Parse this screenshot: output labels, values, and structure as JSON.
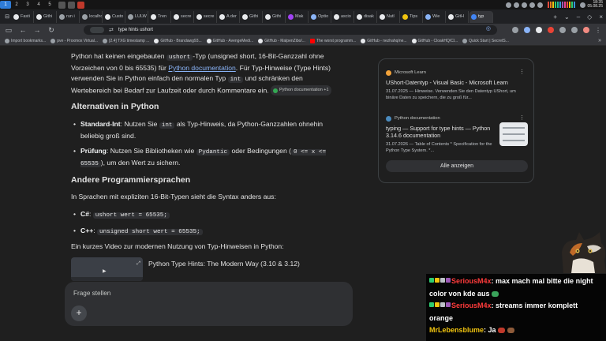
{
  "os": {
    "workspaces": [
      "1",
      "2",
      "3",
      "4",
      "5"
    ],
    "active_workspace": "1",
    "clock_time": "18:35",
    "clock_date": "05.08.25"
  },
  "tabs": [
    {
      "label": "Fasti"
    },
    {
      "label": "Githi"
    },
    {
      "label": "run i"
    },
    {
      "label": "localhos"
    },
    {
      "label": "Custo"
    },
    {
      "label": "LULW"
    },
    {
      "label": "Tren"
    },
    {
      "label": "secre"
    },
    {
      "label": "secre"
    },
    {
      "label": "A der"
    },
    {
      "label": "Githi"
    },
    {
      "label": "Githi"
    },
    {
      "label": "Mak"
    },
    {
      "label": "Optio"
    },
    {
      "label": "ascio"
    },
    {
      "label": "disak"
    },
    {
      "label": "Nutl"
    },
    {
      "label": "Tips"
    },
    {
      "label": "Wie"
    },
    {
      "label": "GitH"
    },
    {
      "label": "typ"
    }
  ],
  "omnibox": {
    "value": "type hints ushort"
  },
  "bookmarks": [
    {
      "label": "Import bookmarks...",
      "type": "plain"
    },
    {
      "label": "pve - Proxmox Virtual...",
      "type": "plain"
    },
    {
      "label": "[2.4] TXG timestamp ...",
      "type": "plain"
    },
    {
      "label": "GitHub - Brandawg93...",
      "type": "github"
    },
    {
      "label": "GitHub - AvengeMedi...",
      "type": "github"
    },
    {
      "label": "GitHub - MalpenZibo/...",
      "type": "github"
    },
    {
      "label": "The worst programm...",
      "type": "yt"
    },
    {
      "label": "GitHub - nezhahq/ne...",
      "type": "github"
    },
    {
      "label": "GitHub - CloakHQ/Cl...",
      "type": "github"
    },
    {
      "label": "Quick Start | SecretS...",
      "type": "plain"
    }
  ],
  "answer": {
    "p1_a": "Python hat keinen eingebauten ",
    "p1_code": "ushort",
    "p1_b": "-Typ (unsigned short, 16-Bit-Ganzzahl ohne Vorzeichen von 0 bis 65535) für ",
    "p1_link": "Python documentation",
    "p1_c": ". Für Typ-Hinweise (Type Hints) verwenden Sie in Python einfach den normalen Typ ",
    "p1_code2": "int",
    "p1_d": " und schränken den Wertebereich bei Bedarf zur Laufzeit oder durch Kommentare ein.",
    "p1_chip": "Python documentation +1",
    "h_alternatives": "Alternativen in Python",
    "alt1_term": "Standard-Int",
    "alt1_a": ": Nutzen Sie ",
    "alt1_code": "int",
    "alt1_b": " als Typ-Hinweis, da Python-Ganzzahlen ohnehin beliebig groß sind.",
    "alt2_term": "Prüfung",
    "alt2_a": ": Nutzen Sie Bibliotheken wie ",
    "alt2_code": "Pydantic",
    "alt2_b": " oder Bedingungen (",
    "alt2_code2": "0 <= x <= 65535",
    "alt2_c": "), um den Wert zu sichern.",
    "h_other": "Andere Programmiersprachen",
    "p_inlang": "In Sprachen mit expliziten 16-Bit-Typen sieht die Syntax anders aus:",
    "lang1_term": "C#",
    "lang1_code": "ushort wert = 65535;",
    "lang2_term": "C++",
    "lang2_code": "unsigned short wert = 65535;",
    "p_video": "Ein kurzes Video zur modernen Nutzung von Typ-Hinweisen in Python:",
    "video_title": "Python Type Hints: The Modern Way (3.10 & 3.12)"
  },
  "sources": {
    "items": [
      {
        "site": "Microsoft Learn",
        "title": "UShort-Datentyp - Visual Basic - Microsoft Learn",
        "snippet": "31.07.2025 — Hinweise. Verwenden Sie den Datentyp UShort, um binäre Daten zu speichern, die zu groß für...",
        "logo_color": "#f3a33a"
      },
      {
        "site": "Python documentation",
        "title": "typing — Support for type hints — Python 3.14.6 documentation",
        "snippet": "31.07.2026 — Table of Contents * Specification for the Python Type System. *...",
        "logo_color": "#4b8bbe"
      }
    ],
    "show_all": "Alle anzeigen"
  },
  "ask": {
    "placeholder": "Frage stellen",
    "plus": "+"
  },
  "chat": {
    "messages": [
      {
        "user": "SeriousM4x",
        "sep": ": ",
        "text": "max mach mal bitte die night color von kde aus"
      },
      {
        "user": "SeriousM4x",
        "sep": ": ",
        "text": "streams immer komplett orange"
      },
      {
        "user": "MrLebensblume",
        "sep": ": ",
        "text": "Ja"
      }
    ]
  },
  "colors": {
    "accent": "#8ab4f8",
    "chat_user_1": "#ff3b3b",
    "chat_user_2": "#f1c40f",
    "workspace_active": "#2e7bd6"
  }
}
